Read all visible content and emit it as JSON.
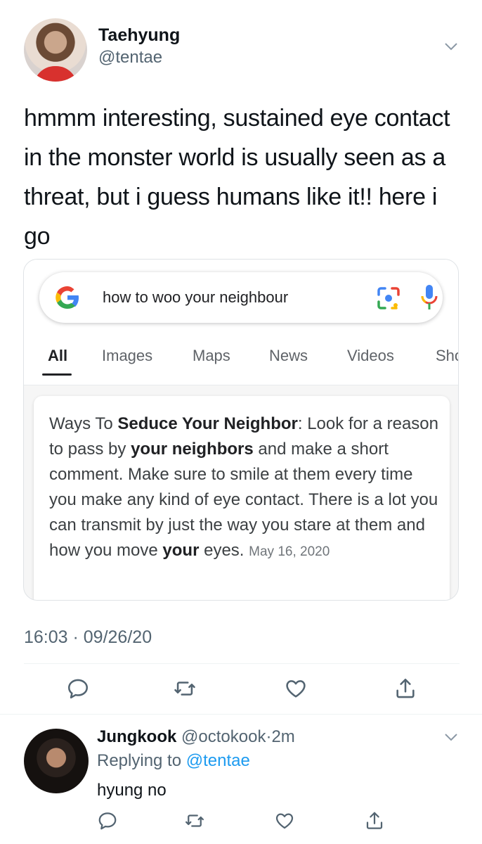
{
  "tweet": {
    "author_name": "Taehyung",
    "author_handle": "@tentae",
    "text": "hmmm interesting, sustained eye contact in the monster world is usually seen as a threat, but i guess humans like it!! here i go",
    "timestamp": "16:03 · 09/26/20"
  },
  "google_card": {
    "query": "how to woo your neighbour",
    "tabs": [
      "All",
      "Images",
      "Maps",
      "News",
      "Videos",
      "Sho"
    ],
    "active_tab": "All",
    "snippet": {
      "t1": "Ways To ",
      "b1": "Seduce Your Neighbor",
      "t2": ": Look for a reason to pass by ",
      "b2": "your neighbors",
      "t3": " and make a short comment. Make sure to smile at them every time you make any kind of eye contact. There is a lot you can transmit by just the way you stare at them and how you move ",
      "b3": "your",
      "t4": " eyes. ",
      "date": "May 16, 2020"
    },
    "colors": {
      "blue": "#4285f4",
      "red": "#ea4335",
      "yellow": "#fbbc05",
      "green": "#34a853"
    }
  },
  "actions": [
    "reply-icon",
    "retweet-icon",
    "like-icon",
    "share-icon"
  ],
  "reply": {
    "author_name": "Jungkook",
    "author_handle": "@octokook",
    "separator": "·",
    "time": "2m",
    "replying_to_label": "Replying to ",
    "replying_to_handle": "@tentae",
    "text": "hyung no"
  },
  "colors": {
    "text": "#0f1419",
    "secondary": "#536471",
    "link": "#1d9bf0"
  }
}
